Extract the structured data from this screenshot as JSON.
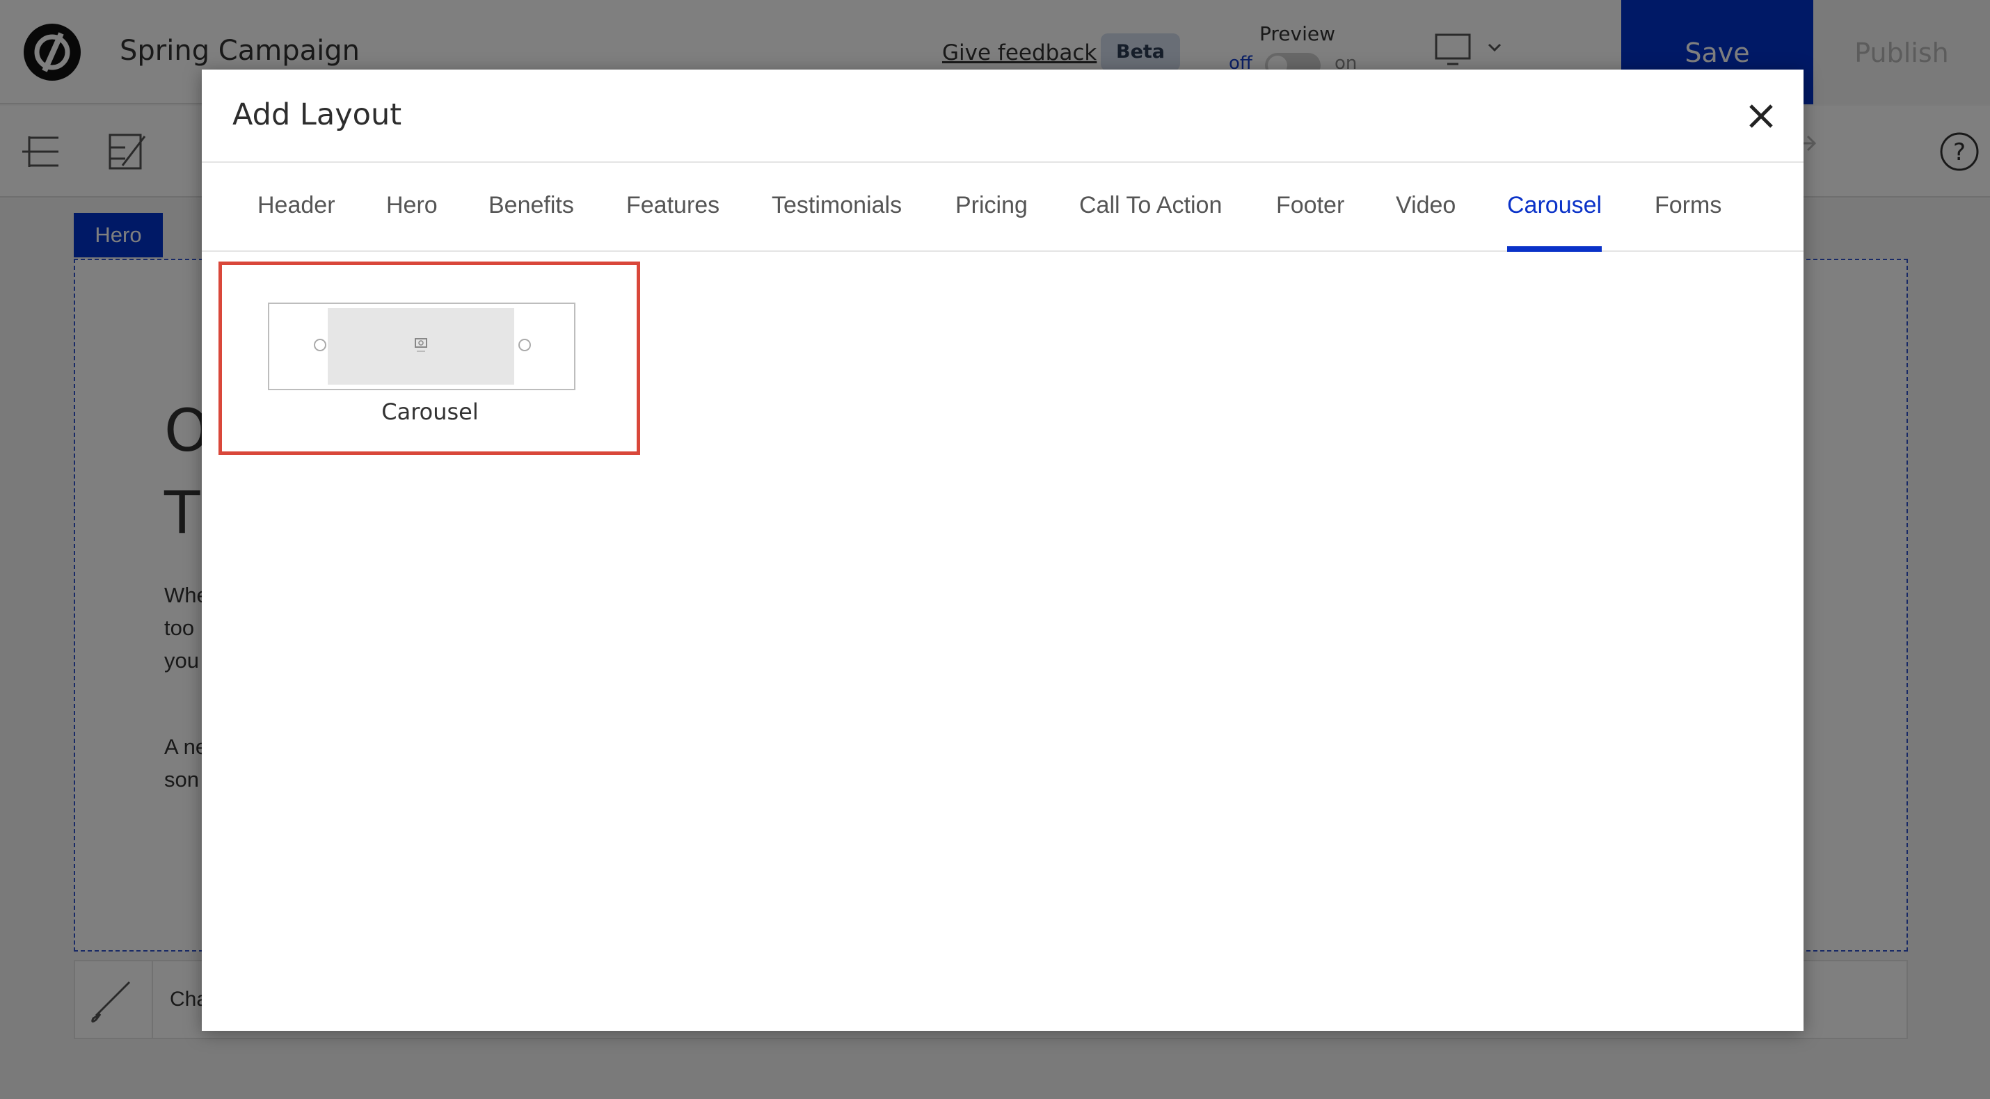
{
  "editor": {
    "campaign_title": "Spring Campaign",
    "feedback_link": "Give feedback",
    "beta_badge": "Beta",
    "preview": {
      "label": "Preview",
      "off_label": "off",
      "on_label": "on",
      "state": "off"
    },
    "save_label": "Save",
    "publish_label": "Publish",
    "hero_tag": "Hero",
    "hero_heading_lines": [
      "O",
      "T"
    ],
    "hero_body_lines": [
      "Whe",
      "too",
      "you"
    ],
    "hero_body2_lines": [
      "A ne",
      "son"
    ],
    "bottom_tool_text": "Cha",
    "colors": {
      "accent": "#0033cc",
      "highlight": "#d9473a"
    }
  },
  "modal": {
    "title": "Add Layout",
    "close_icon": "close-icon",
    "tabs": [
      {
        "label": "Header",
        "active": false
      },
      {
        "label": "Hero",
        "active": false
      },
      {
        "label": "Benefits",
        "active": false
      },
      {
        "label": "Features",
        "active": false
      },
      {
        "label": "Testimonials",
        "active": false
      },
      {
        "label": "Pricing",
        "active": false
      },
      {
        "label": "Call To Action",
        "active": false
      },
      {
        "label": "Footer",
        "active": false
      },
      {
        "label": "Video",
        "active": false
      },
      {
        "label": "Carousel",
        "active": true
      },
      {
        "label": "Forms",
        "active": false
      }
    ],
    "layouts": [
      {
        "label": "Carousel",
        "icon": "camera-icon"
      }
    ]
  }
}
